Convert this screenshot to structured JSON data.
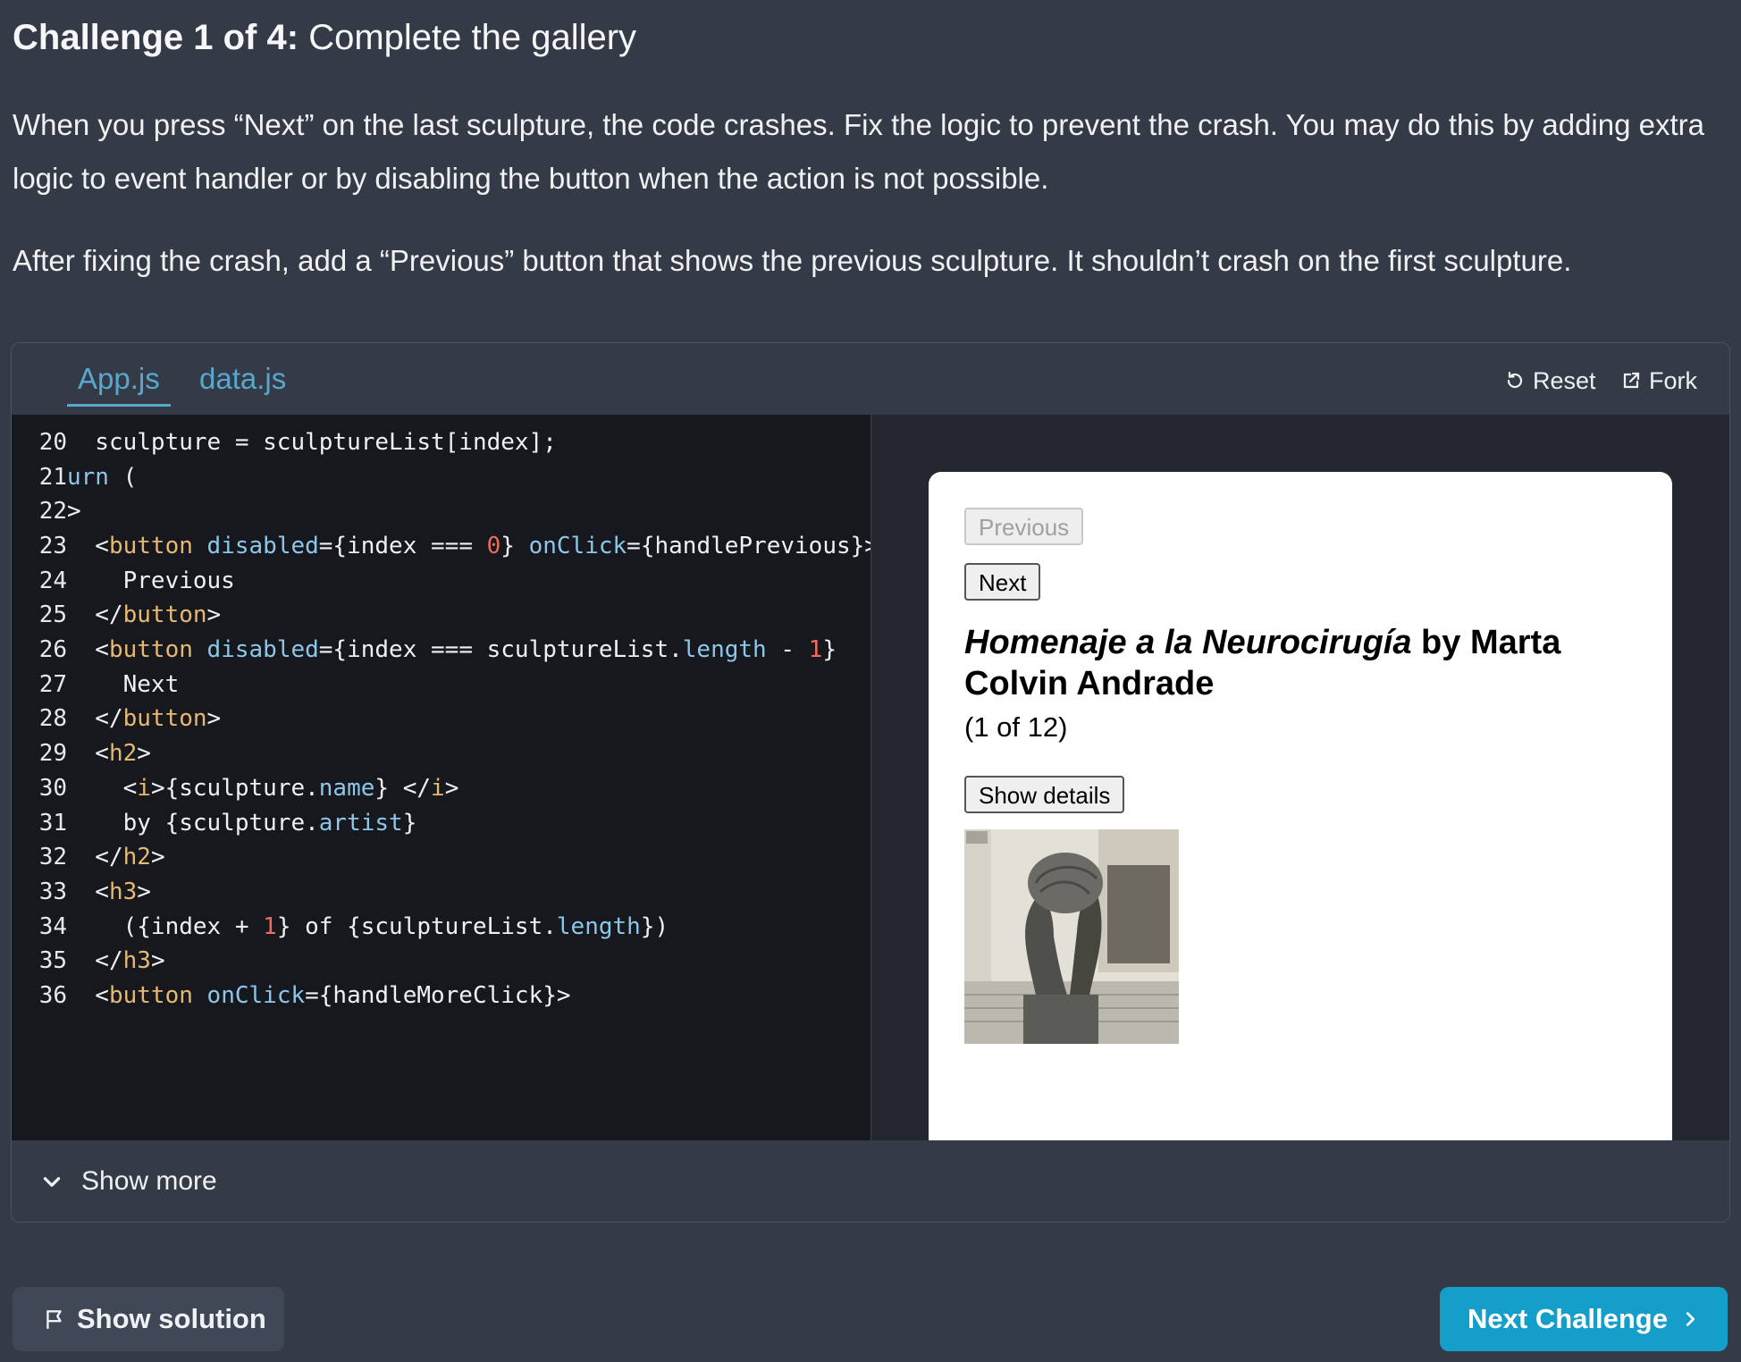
{
  "challenge": {
    "title_prefix": "Challenge 1 of 4:",
    "title": "Complete the gallery",
    "paragraph1": "When you press “Next” on the last sculpture, the code crashes. Fix the logic to prevent the crash. You may do this by adding extra logic to event handler or by disabling the button when the action is not possible.",
    "paragraph2": "After fixing the crash, add a “Previous” button that shows the previous sculpture. It shouldn’t crash on the first sculpture."
  },
  "sandbox": {
    "tabs": [
      {
        "label": "App.js",
        "active": true
      },
      {
        "label": "data.js",
        "active": false
      }
    ],
    "reset_label": "Reset",
    "fork_label": "Fork",
    "code": {
      "line_numbers": [
        "20",
        "21",
        "22",
        "23",
        "24",
        "25",
        "26",
        "27",
        "28",
        "29",
        "30",
        "31",
        "32",
        "33",
        "34",
        "35",
        "36"
      ]
    },
    "preview": {
      "previous_label": "Previous",
      "next_label": "Next",
      "sculpture_name": "Homenaje a la Neurocirugía",
      "sculpture_by": " by Marta Colvin Andrade",
      "counter": "(1 of 12)",
      "details_label": "Show details"
    },
    "show_more_label": "Show more"
  },
  "footer": {
    "show_solution_label": "Show solution",
    "next_challenge_label": "Next Challenge"
  },
  "colors": {
    "accent": "#149eca",
    "link": "#58a7cf",
    "page_bg": "#343a46",
    "editor_bg": "#16181d"
  }
}
